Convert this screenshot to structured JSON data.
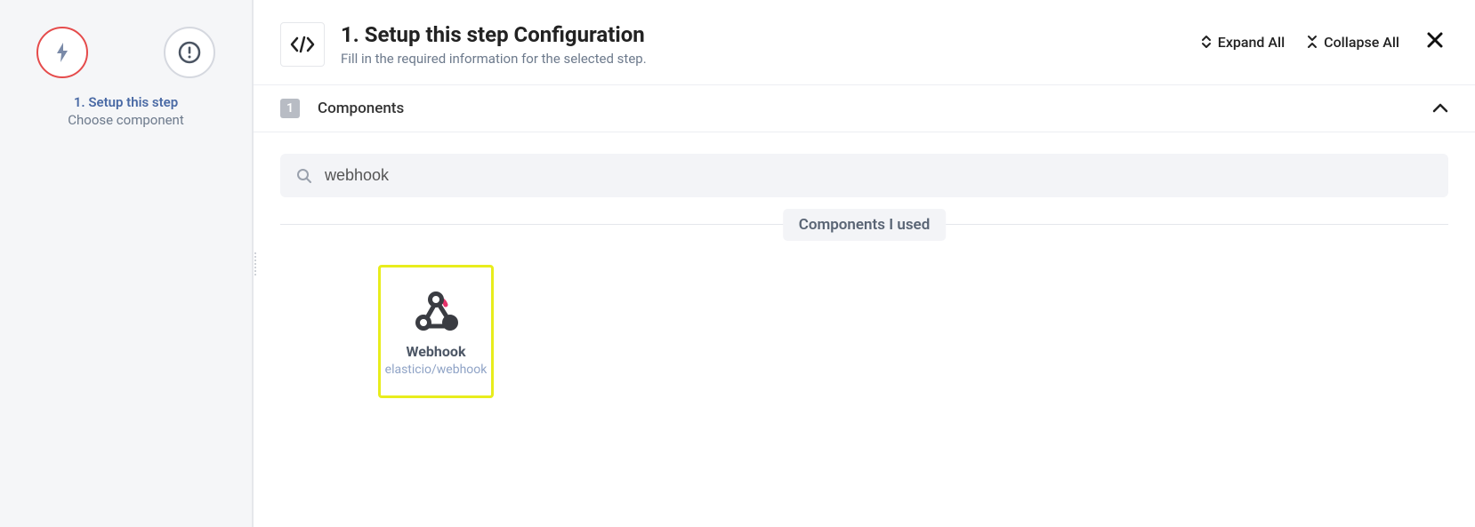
{
  "sidebar": {
    "step_title": "1. Setup this step",
    "step_subtitle": "Choose component"
  },
  "header": {
    "title": "1. Setup this step Configuration",
    "subtitle": "Fill in the required information for the selected step.",
    "expand_label": "Expand All",
    "collapse_label": "Collapse All"
  },
  "section": {
    "badge": "1",
    "title": "Components"
  },
  "search": {
    "value": "webhook"
  },
  "divider": {
    "label": "Components I used"
  },
  "results": [
    {
      "title": "Webhook",
      "subtitle": "elasticio/webhook"
    }
  ]
}
